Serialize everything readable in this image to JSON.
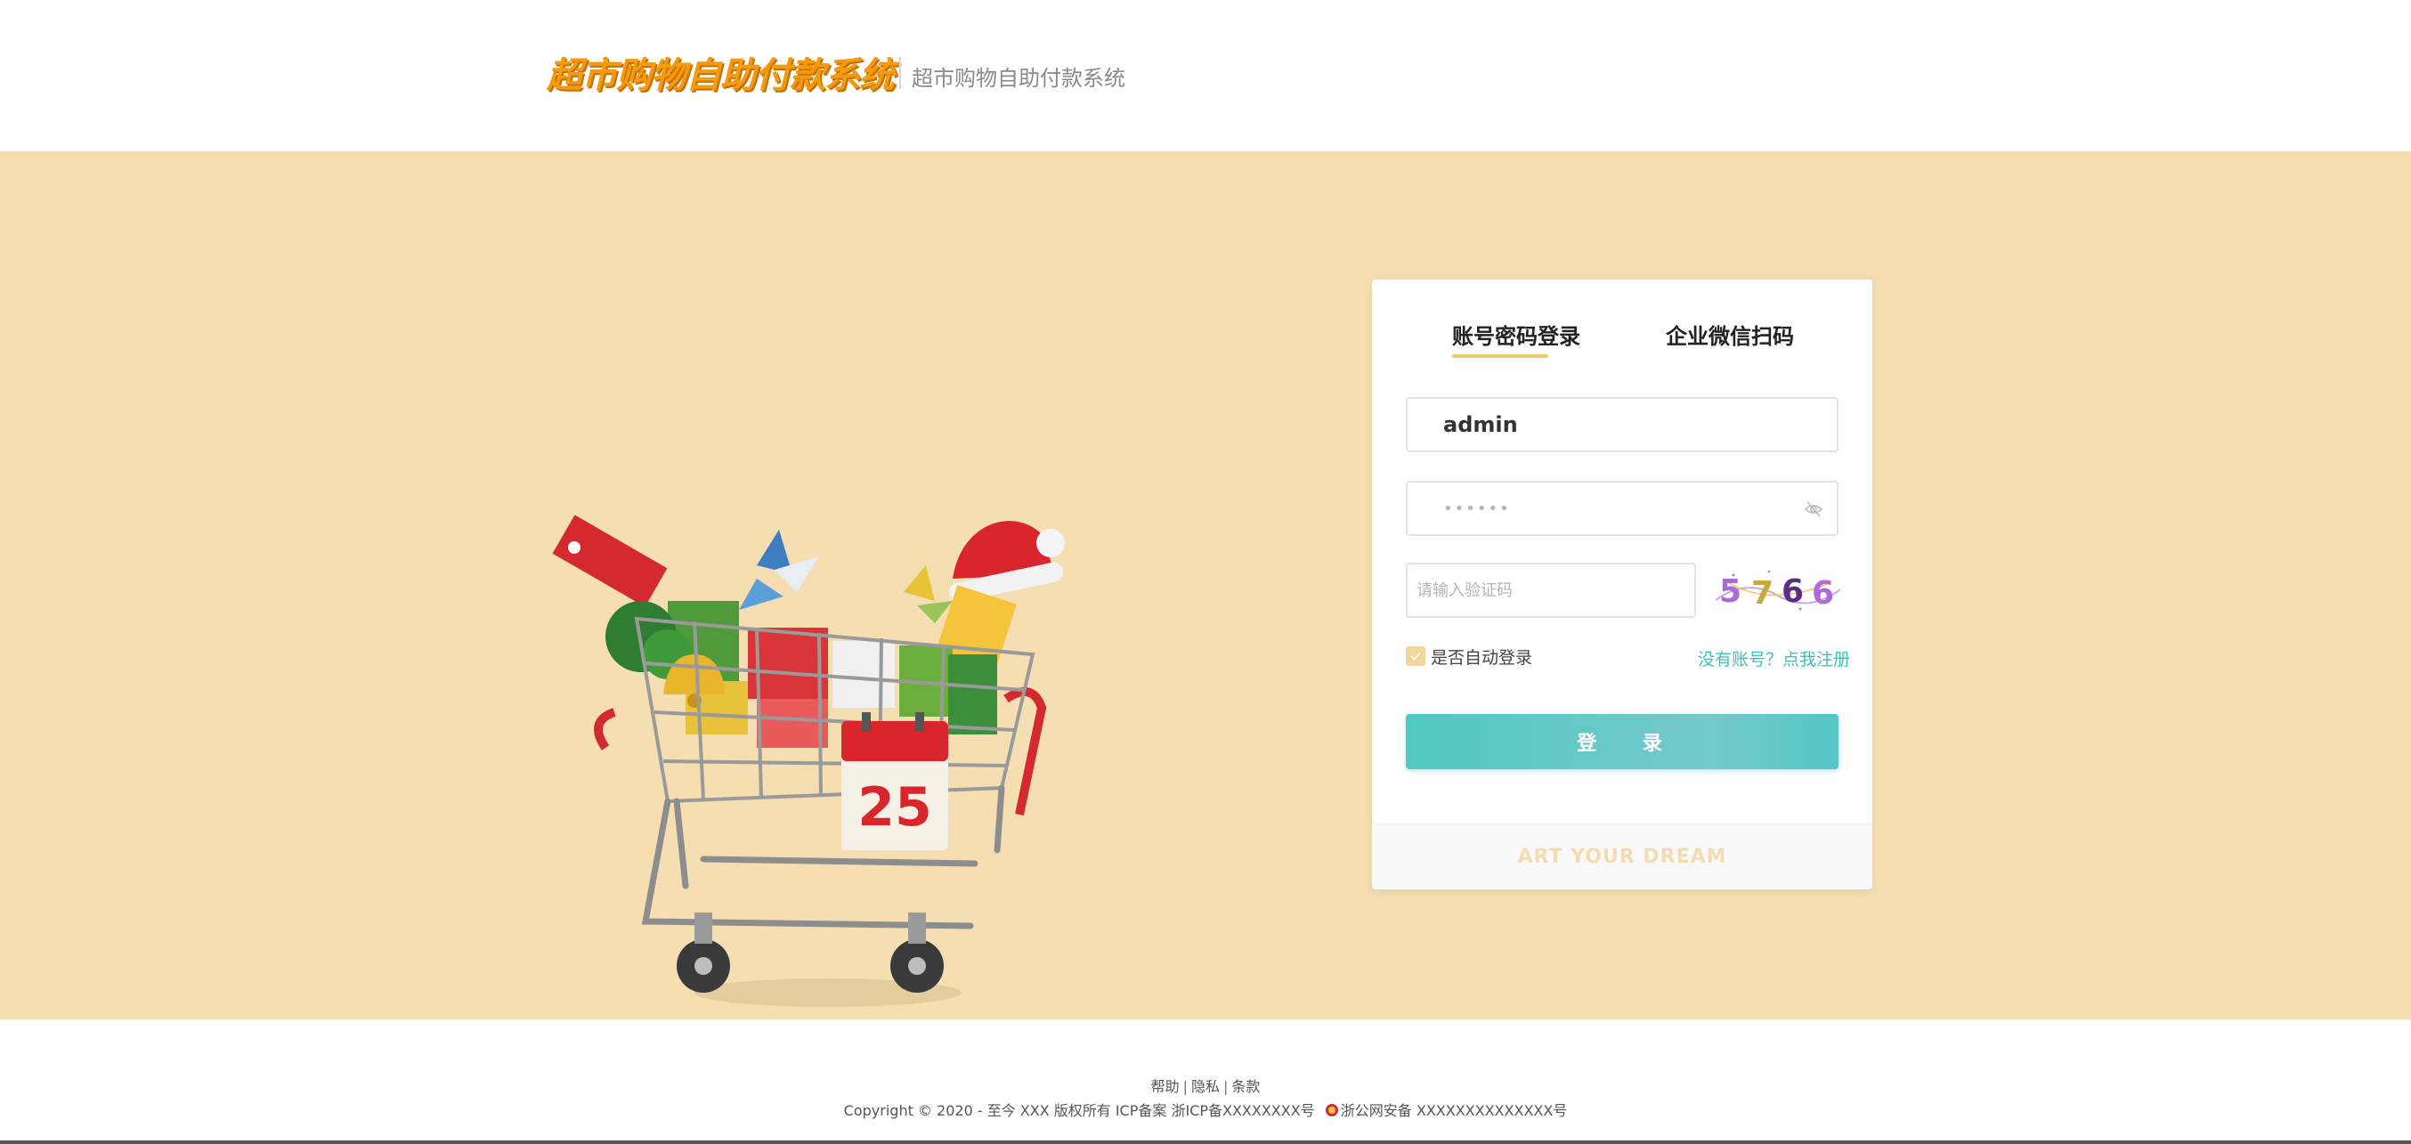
{
  "header": {
    "logo_text": "超市购物自助付款系统",
    "subtitle": "超市购物自助付款系统"
  },
  "illustration": {
    "calendar_day": "25"
  },
  "login": {
    "tabs": [
      {
        "label": "账号密码登录",
        "active": true
      },
      {
        "label": "企业微信扫码",
        "active": false
      }
    ],
    "username_value": "admin",
    "password_value": "••••••",
    "captcha_placeholder": "请输入验证码",
    "captcha_text": [
      "5",
      "7",
      "6",
      "6"
    ],
    "remember_label": "是否自动登录",
    "remember_checked": true,
    "register_link": "没有账号？点我注册",
    "submit_label": "登 录",
    "footer_text": "ART YOUR DREAM"
  },
  "footer": {
    "links": [
      "帮助",
      "隐私",
      "条款"
    ],
    "copyright": "Copyright © 2020 - 至今 XXX 版权所有 ICP备案 浙ICP备XXXXXXXX号",
    "police_record": "浙公网安备 XXXXXXXXXXXXXX号"
  },
  "colors": {
    "band_bg": "#f4deb2",
    "logo_orange": "#f39a0e",
    "accent_teal": "#52c9c3",
    "tab_underline": "#f0c96a"
  },
  "icons": {
    "password_toggle": "eye-off-icon",
    "police": "police-badge-icon"
  }
}
